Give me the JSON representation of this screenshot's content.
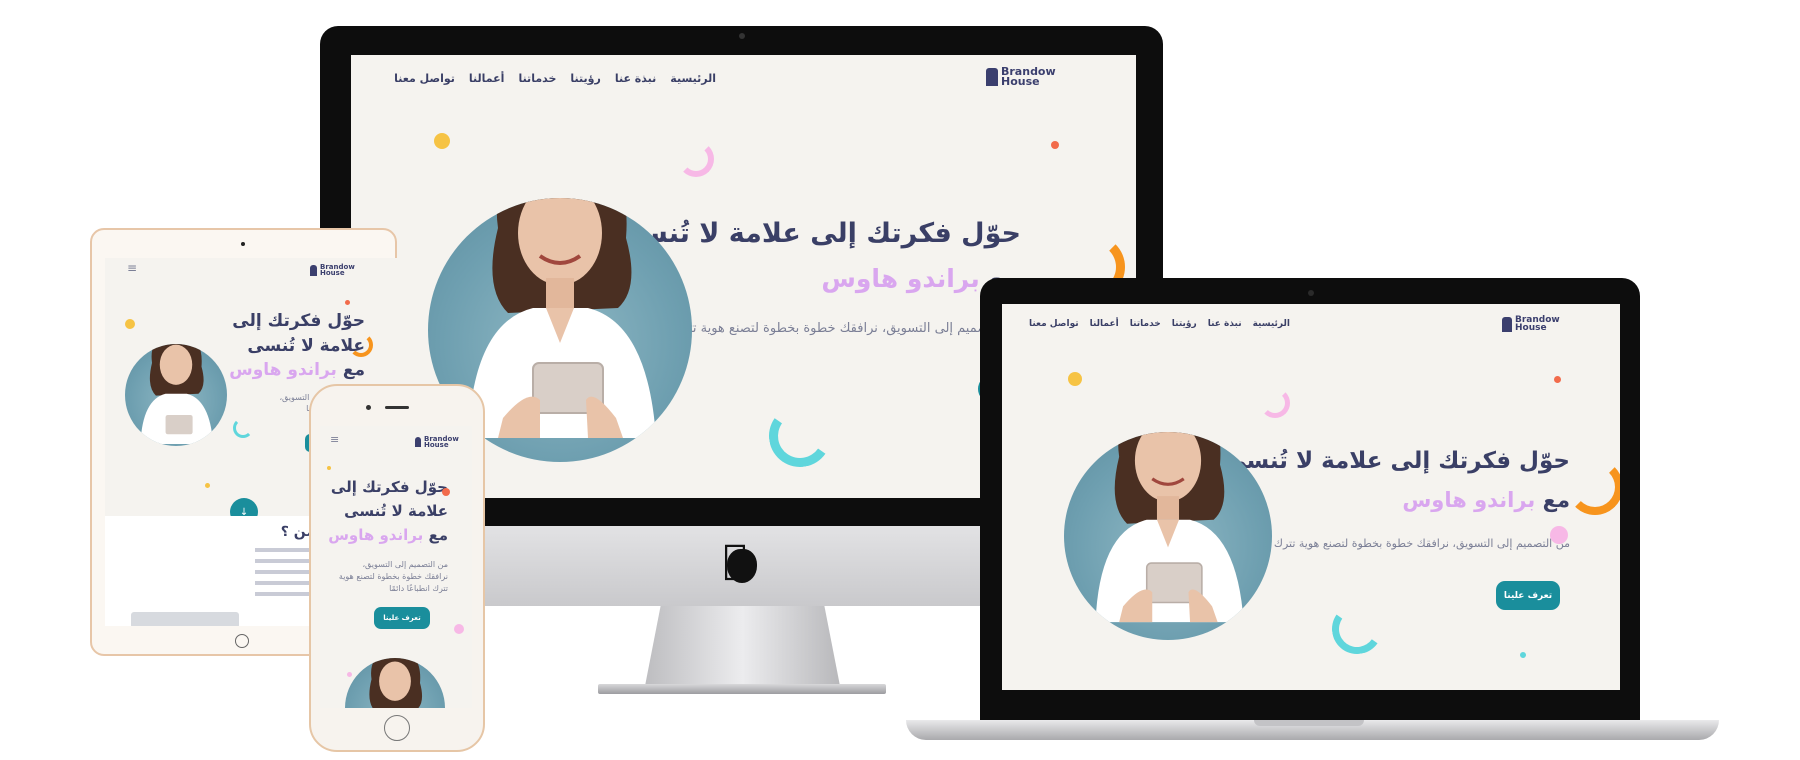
{
  "site": {
    "brand_line1": "Brandow",
    "brand_line2": "House",
    "nav": [
      "الرئيسية",
      "نبذة عنا",
      "رؤيتنا",
      "خدماتنا",
      "أعمالنا",
      "تواصل معنا"
    ],
    "hero_title_line1": "حوّل فكرتك إلى علامة لا تُنسى",
    "hero_title_with": "مع",
    "hero_title_brand": "براندو هاوس",
    "hero_subtitle": "من التصميم إلى التسويق، نرافقك خطوة بخطوة لتصنع هوية تترك انطباعًا دائمًا",
    "cta_label": "تعرف علينا",
    "mobile_title_l1": "حوّل فكرتك إلى",
    "mobile_title_l2": "علامة لا تُنسى",
    "mobile_sub_l1": "من التصميم إلى التسويق،",
    "mobile_sub_l2": "نرافقك خطوة بخطوة لتصنع هوية",
    "mobile_sub_l3": "تترك انطباعًا دائمًا",
    "tablet_section_title": "من ؟",
    "hamburger_glyph": "≡",
    "down_arrow": "↓"
  },
  "colors": {
    "accent_teal": "#1a8e9c",
    "title_navy": "#3a3f66",
    "brand_lilac": "#d9a6ef",
    "orange": "#f7941d",
    "cyan": "#5fd6dc",
    "pink": "#f7b8e6",
    "yellow": "#f6c344",
    "coral": "#f26b4b"
  }
}
